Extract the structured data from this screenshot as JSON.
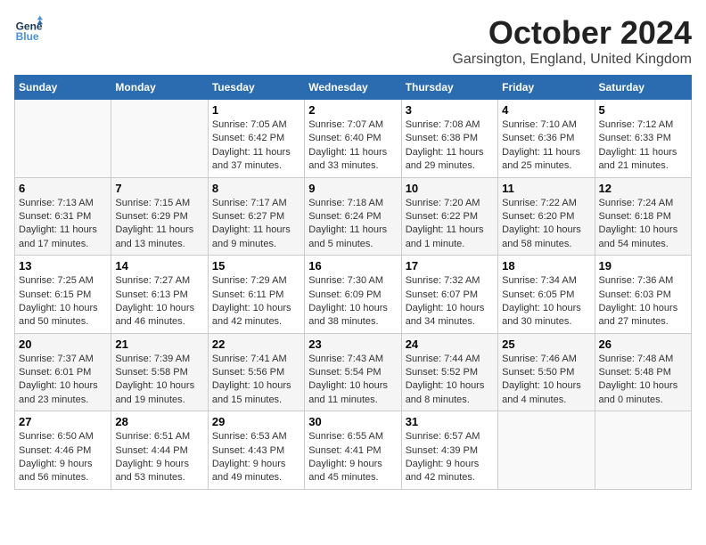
{
  "logo": {
    "line1": "General",
    "line2": "Blue"
  },
  "title": "October 2024",
  "subtitle": "Garsington, England, United Kingdom",
  "days": [
    "Sunday",
    "Monday",
    "Tuesday",
    "Wednesday",
    "Thursday",
    "Friday",
    "Saturday"
  ],
  "weeks": [
    [
      {
        "date": "",
        "text": ""
      },
      {
        "date": "",
        "text": ""
      },
      {
        "date": "1",
        "text": "Sunrise: 7:05 AM\nSunset: 6:42 PM\nDaylight: 11 hours and 37 minutes."
      },
      {
        "date": "2",
        "text": "Sunrise: 7:07 AM\nSunset: 6:40 PM\nDaylight: 11 hours and 33 minutes."
      },
      {
        "date": "3",
        "text": "Sunrise: 7:08 AM\nSunset: 6:38 PM\nDaylight: 11 hours and 29 minutes."
      },
      {
        "date": "4",
        "text": "Sunrise: 7:10 AM\nSunset: 6:36 PM\nDaylight: 11 hours and 25 minutes."
      },
      {
        "date": "5",
        "text": "Sunrise: 7:12 AM\nSunset: 6:33 PM\nDaylight: 11 hours and 21 minutes."
      }
    ],
    [
      {
        "date": "6",
        "text": "Sunrise: 7:13 AM\nSunset: 6:31 PM\nDaylight: 11 hours and 17 minutes."
      },
      {
        "date": "7",
        "text": "Sunrise: 7:15 AM\nSunset: 6:29 PM\nDaylight: 11 hours and 13 minutes."
      },
      {
        "date": "8",
        "text": "Sunrise: 7:17 AM\nSunset: 6:27 PM\nDaylight: 11 hours and 9 minutes."
      },
      {
        "date": "9",
        "text": "Sunrise: 7:18 AM\nSunset: 6:24 PM\nDaylight: 11 hours and 5 minutes."
      },
      {
        "date": "10",
        "text": "Sunrise: 7:20 AM\nSunset: 6:22 PM\nDaylight: 11 hours and 1 minute."
      },
      {
        "date": "11",
        "text": "Sunrise: 7:22 AM\nSunset: 6:20 PM\nDaylight: 10 hours and 58 minutes."
      },
      {
        "date": "12",
        "text": "Sunrise: 7:24 AM\nSunset: 6:18 PM\nDaylight: 10 hours and 54 minutes."
      }
    ],
    [
      {
        "date": "13",
        "text": "Sunrise: 7:25 AM\nSunset: 6:15 PM\nDaylight: 10 hours and 50 minutes."
      },
      {
        "date": "14",
        "text": "Sunrise: 7:27 AM\nSunset: 6:13 PM\nDaylight: 10 hours and 46 minutes."
      },
      {
        "date": "15",
        "text": "Sunrise: 7:29 AM\nSunset: 6:11 PM\nDaylight: 10 hours and 42 minutes."
      },
      {
        "date": "16",
        "text": "Sunrise: 7:30 AM\nSunset: 6:09 PM\nDaylight: 10 hours and 38 minutes."
      },
      {
        "date": "17",
        "text": "Sunrise: 7:32 AM\nSunset: 6:07 PM\nDaylight: 10 hours and 34 minutes."
      },
      {
        "date": "18",
        "text": "Sunrise: 7:34 AM\nSunset: 6:05 PM\nDaylight: 10 hours and 30 minutes."
      },
      {
        "date": "19",
        "text": "Sunrise: 7:36 AM\nSunset: 6:03 PM\nDaylight: 10 hours and 27 minutes."
      }
    ],
    [
      {
        "date": "20",
        "text": "Sunrise: 7:37 AM\nSunset: 6:01 PM\nDaylight: 10 hours and 23 minutes."
      },
      {
        "date": "21",
        "text": "Sunrise: 7:39 AM\nSunset: 5:58 PM\nDaylight: 10 hours and 19 minutes."
      },
      {
        "date": "22",
        "text": "Sunrise: 7:41 AM\nSunset: 5:56 PM\nDaylight: 10 hours and 15 minutes."
      },
      {
        "date": "23",
        "text": "Sunrise: 7:43 AM\nSunset: 5:54 PM\nDaylight: 10 hours and 11 minutes."
      },
      {
        "date": "24",
        "text": "Sunrise: 7:44 AM\nSunset: 5:52 PM\nDaylight: 10 hours and 8 minutes."
      },
      {
        "date": "25",
        "text": "Sunrise: 7:46 AM\nSunset: 5:50 PM\nDaylight: 10 hours and 4 minutes."
      },
      {
        "date": "26",
        "text": "Sunrise: 7:48 AM\nSunset: 5:48 PM\nDaylight: 10 hours and 0 minutes."
      }
    ],
    [
      {
        "date": "27",
        "text": "Sunrise: 6:50 AM\nSunset: 4:46 PM\nDaylight: 9 hours and 56 minutes."
      },
      {
        "date": "28",
        "text": "Sunrise: 6:51 AM\nSunset: 4:44 PM\nDaylight: 9 hours and 53 minutes."
      },
      {
        "date": "29",
        "text": "Sunrise: 6:53 AM\nSunset: 4:43 PM\nDaylight: 9 hours and 49 minutes."
      },
      {
        "date": "30",
        "text": "Sunrise: 6:55 AM\nSunset: 4:41 PM\nDaylight: 9 hours and 45 minutes."
      },
      {
        "date": "31",
        "text": "Sunrise: 6:57 AM\nSunset: 4:39 PM\nDaylight: 9 hours and 42 minutes."
      },
      {
        "date": "",
        "text": ""
      },
      {
        "date": "",
        "text": ""
      }
    ]
  ]
}
